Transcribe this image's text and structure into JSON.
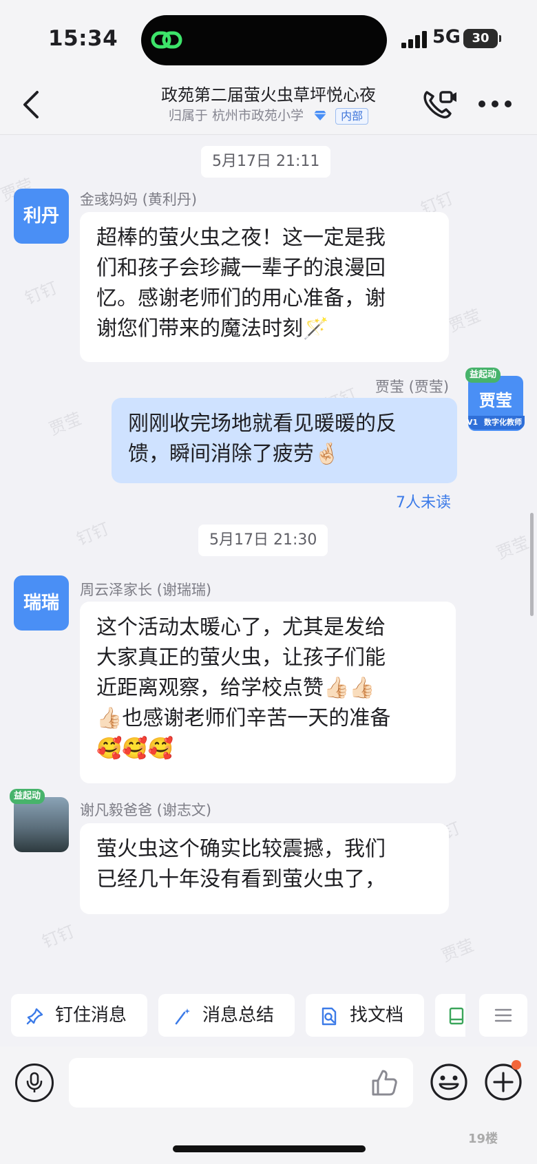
{
  "status_bar": {
    "time": "15:34",
    "network": "5G",
    "battery": "30"
  },
  "header": {
    "title": "政苑第二届萤火虫草坪悦心夜",
    "belongs_prefix": "归属于",
    "org": "杭州市政苑小学",
    "badge": "内部"
  },
  "watermark_texts": [
    "钉钉",
    "贾莹"
  ],
  "messages": [
    {
      "type": "time",
      "text": "5月17日 21:11"
    },
    {
      "type": "in",
      "avatar": "利丹",
      "sender": "金彧妈妈 (黄利丹)",
      "lines": [
        "超棒的萤火虫之夜！这一定是我",
        "们和孩子会珍藏一辈子的浪漫回",
        "忆。感谢老师们的用心准备，谢",
        "谢您们带来的魔法时刻🪄"
      ]
    },
    {
      "type": "out",
      "avatar": "贾莹",
      "avatar_tag_top": "益起动",
      "avatar_tag_bottom": "数字化教师",
      "avatar_level": "V1",
      "sender": "贾莹 (贾莹)",
      "lines": [
        "刚刚收完场地就看见暖暖的反",
        "馈，瞬间消除了疲劳🤞🏻"
      ],
      "unread": "7人未读"
    },
    {
      "type": "time",
      "text": "5月17日 21:30"
    },
    {
      "type": "in",
      "avatar": "瑞瑞",
      "sender": "周云泽家长 (谢瑞瑞)",
      "lines": [
        "这个活动太暖心了，尤其是发给",
        "大家真正的萤火虫，让孩子们能",
        "近距离观察，给学校点赞👍🏻👍🏻",
        "👍🏻也感谢老师们辛苦一天的准备",
        "🥰🥰🥰"
      ]
    },
    {
      "type": "in",
      "avatar": "",
      "avatar_tag_top": "益起动",
      "sender": "谢凡毅爸爸 (谢志文)",
      "lines": [
        "萤火虫这个确实比较震撼，我们",
        "已经几十年没有看到萤火虫了，"
      ]
    }
  ],
  "quick_actions": [
    {
      "label": "钉住消息",
      "icon": "pin-icon"
    },
    {
      "label": "消息总结",
      "icon": "magic-wand-icon"
    },
    {
      "label": "找文档",
      "icon": "doc-search-icon"
    }
  ],
  "input": {
    "placeholder": ""
  },
  "footer_logo": "19楼"
}
